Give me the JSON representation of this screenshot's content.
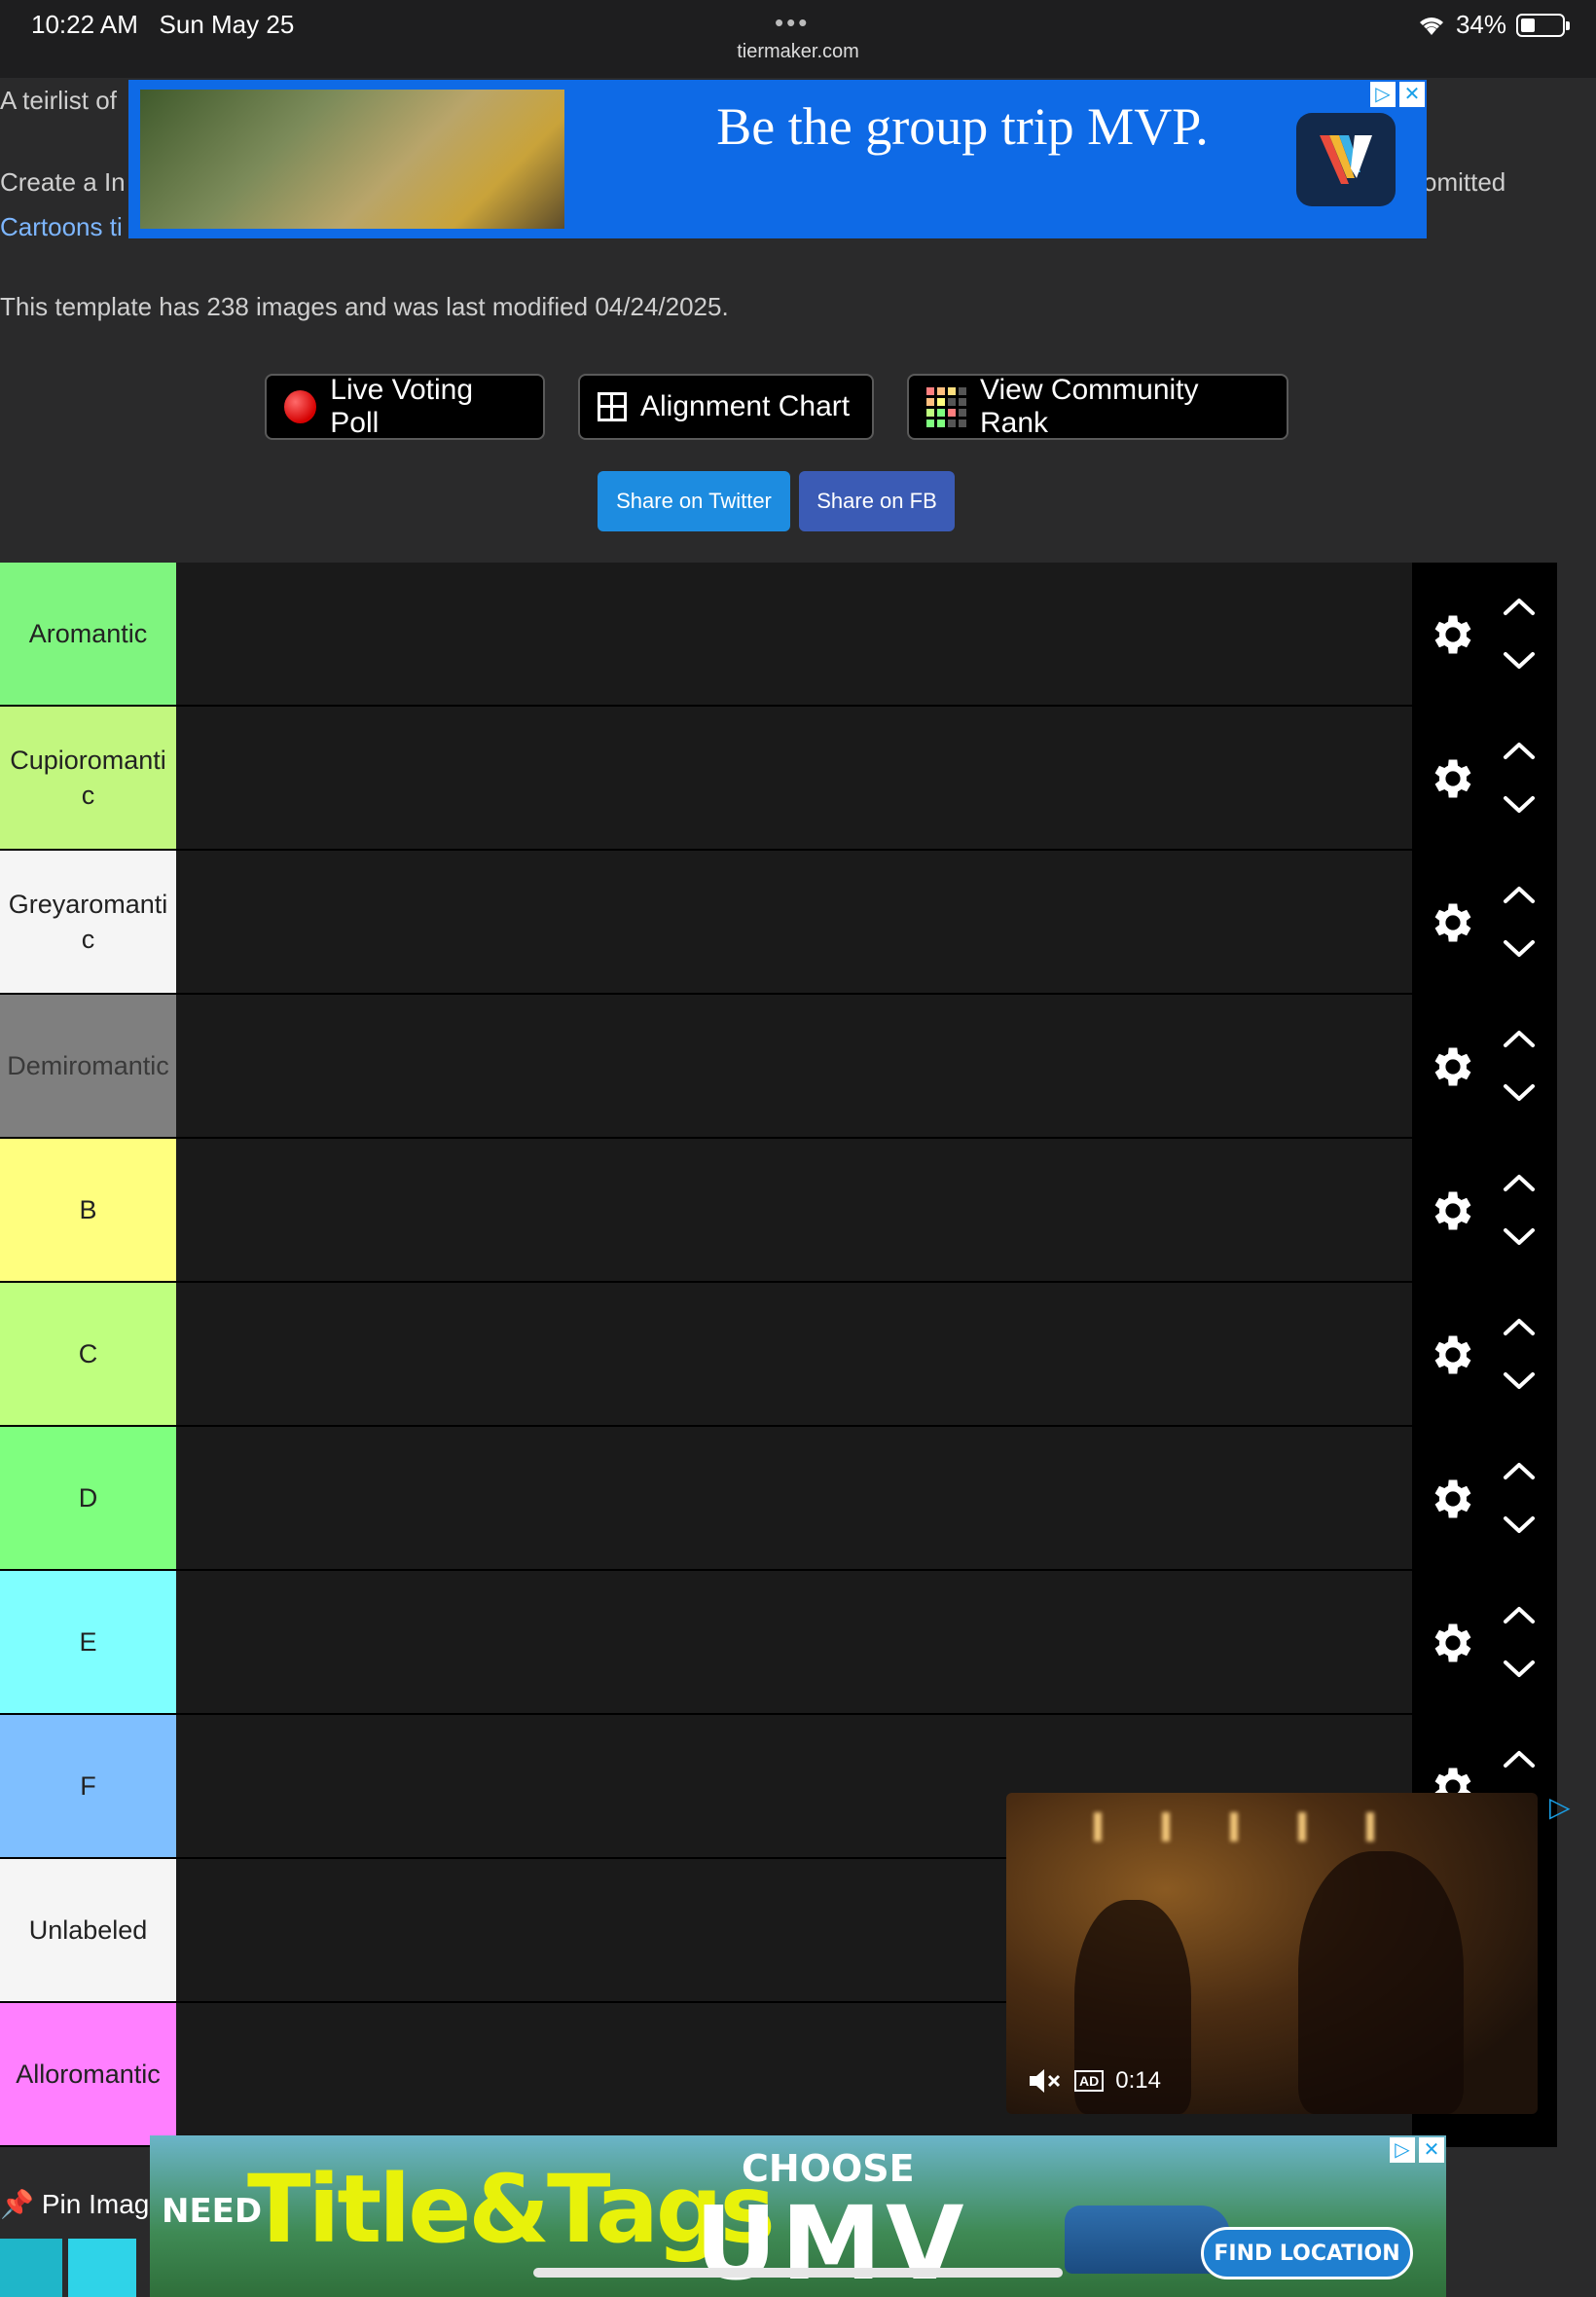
{
  "status_bar": {
    "time": "10:22 AM",
    "date": "Sun May 25",
    "dots": "•••",
    "url": "tiermaker.com",
    "battery": "34%",
    "battery_level": 0.34
  },
  "intro": {
    "line1": "A teirlist of",
    "line2": "Create a In",
    "line2_suffix": "omitted",
    "link": "Cartoons ti",
    "template_info": "This template has 238 images and was last modified 04/24/2025."
  },
  "top_ad": {
    "headline": "Be the group trip MVP.",
    "logo_letter": "V"
  },
  "actions": {
    "live_voting": "Live Voting Poll",
    "alignment_chart": "Alignment Chart",
    "community_rank": "View Community Rank",
    "share_twitter": "Share on Twitter",
    "share_fb": "Share on FB"
  },
  "tiers": [
    {
      "label": "Aromantic",
      "color": "#7ff57f"
    },
    {
      "label": "Cupioromantic",
      "color": "#c2f77f"
    },
    {
      "label": "Greyaromantic",
      "color": "#f5f5f5"
    },
    {
      "label": "Demiromantic",
      "color": "#7f7f7f"
    },
    {
      "label": "B",
      "color": "#ffff7f"
    },
    {
      "label": "C",
      "color": "#bfff7f"
    },
    {
      "label": "D",
      "color": "#7fff7f"
    },
    {
      "label": "E",
      "color": "#7fffff"
    },
    {
      "label": "F",
      "color": "#7fbfff"
    },
    {
      "label": "Unlabeled",
      "color": "#f5f5f5"
    },
    {
      "label": "Alloromantic",
      "color": "#ff7fff"
    }
  ],
  "video_ad": {
    "time": "0:14",
    "badge": "AD"
  },
  "pin_images": {
    "label": "Pin Imag"
  },
  "bottom_ad": {
    "need": "NEED",
    "title": "Title&Tags",
    "choose": "CHOOSE",
    "brand": "UMV",
    "cta": "FIND LOCATION"
  },
  "colors": {
    "twitter": "#1d8ce0",
    "facebook": "#3b5bb5",
    "link": "#7db6ff",
    "ad_blue": "#0e6ae6"
  }
}
